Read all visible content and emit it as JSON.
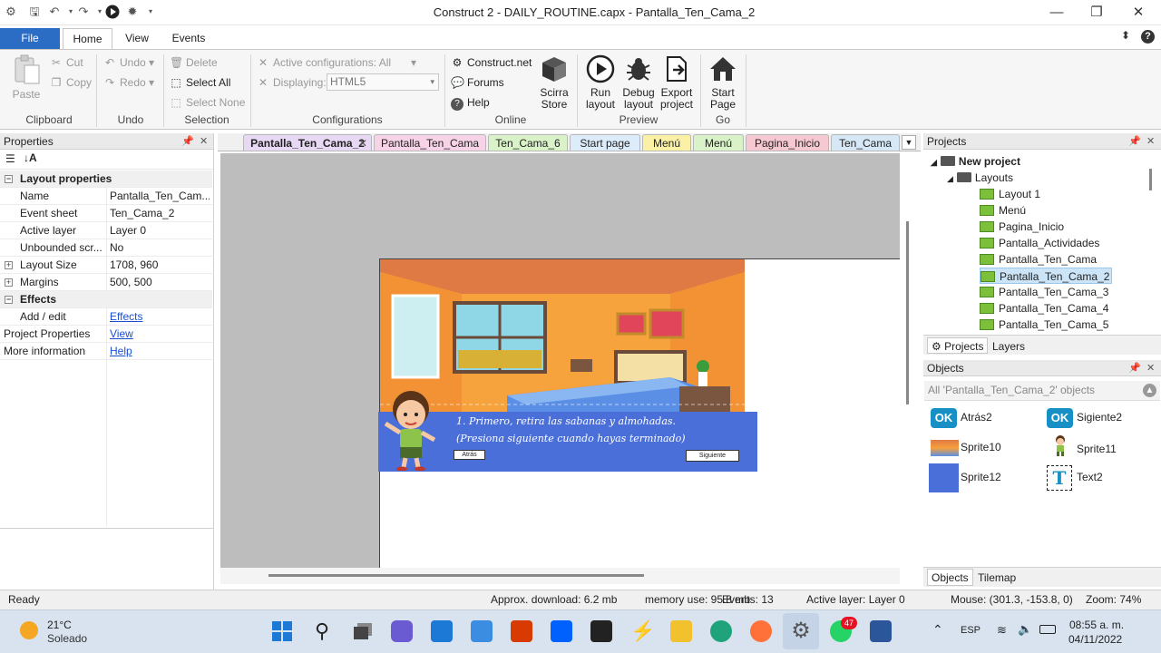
{
  "window": {
    "title": "Construct 2 - DAILY_ROUTINE.capx - Pantalla_Ten_Cama_2",
    "minimize": "—",
    "maximize": "❐",
    "close": "✕"
  },
  "ribbon": {
    "tabs": [
      "File",
      "Home",
      "View",
      "Events"
    ],
    "clipboard": {
      "label": "Clipboard",
      "paste": "Paste",
      "cut": "Cut",
      "copy": "Copy"
    },
    "undo": {
      "label": "Undo",
      "undo": "Undo",
      "redo": "Redo"
    },
    "selection": {
      "label": "Selection",
      "delete": "Delete",
      "select_all": "Select All",
      "select_none": "Select None"
    },
    "configurations": {
      "label": "Configurations",
      "active": "Active configurations: All",
      "displaying_label": "Displaying:",
      "displaying_value": "HTML5"
    },
    "online": {
      "label": "Online",
      "construct": "Construct.net",
      "forums": "Forums",
      "help": "Help",
      "store_line1": "Scirra",
      "store_line2": "Store"
    },
    "preview": {
      "label": "Preview",
      "run_line1": "Run",
      "run_line2": "layout",
      "debug_line1": "Debug",
      "debug_line2": "layout",
      "export_line1": "Export",
      "export_line2": "project"
    },
    "go": {
      "label": "Go",
      "start_line1": "Start",
      "start_line2": "Page"
    }
  },
  "properties": {
    "title": "Properties",
    "section_layout": "Layout properties",
    "rows": [
      {
        "k": "Name",
        "v": "Pantalla_Ten_Cam..."
      },
      {
        "k": "Event sheet",
        "v": "Ten_Cama_2"
      },
      {
        "k": "Active layer",
        "v": "Layer 0"
      },
      {
        "k": "Unbounded scr...",
        "v": "No"
      },
      {
        "k": "Layout Size",
        "v": "1708, 960"
      },
      {
        "k": "Margins",
        "v": "500, 500"
      }
    ],
    "section_effects": "Effects",
    "add_edit": "Add / edit",
    "effects_link": "Effects",
    "project_properties": "Project Properties",
    "view_link": "View",
    "more_information": "More information",
    "help_link": "Help"
  },
  "doc_tabs": [
    {
      "label": "Pantalla_Ten_Cama_2",
      "color": "#e7d8f3"
    },
    {
      "label": "Pantalla_Ten_Cama",
      "color": "#f6d3e6"
    },
    {
      "label": "Ten_Cama_6",
      "color": "#d9f2c7"
    },
    {
      "label": "Start page",
      "color": "#dcecfb"
    },
    {
      "label": "Menú",
      "color": "#fbf1a6"
    },
    {
      "label": "Menú",
      "color": "#d9f2c7"
    },
    {
      "label": "Pagina_Inicio",
      "color": "#f6c9d2"
    },
    {
      "label": "Ten_Cama",
      "color": "#d6e8f6"
    }
  ],
  "scene": {
    "line1": "1. Primero, retira las sabanas y almohadas.",
    "line2": "(Presiona siguiente cuando hayas terminado)",
    "back_btn": "Atrás",
    "next_btn": "Siguiente"
  },
  "projects": {
    "title": "Projects",
    "root": "New project",
    "folder": "Layouts",
    "layouts": [
      "Layout 1",
      "Menú",
      "Pagina_Inicio",
      "Pantalla_Actividades",
      "Pantalla_Ten_Cama",
      "Pantalla_Ten_Cama_2",
      "Pantalla_Ten_Cama_3",
      "Pantalla_Ten_Cama_4",
      "Pantalla_Ten_Cama_5"
    ],
    "tab_projects": "Projects",
    "tab_layers": "Layers"
  },
  "objects": {
    "title": "Objects",
    "filter": "All 'Pantalla_Ten_Cama_2' objects",
    "items": [
      "Atrás2",
      "Sigiente2",
      "Sprite10",
      "Sprite11",
      "Sprite12",
      "Text2"
    ],
    "ok_text": "OK",
    "tab_objects": "Objects",
    "tab_tilemap": "Tilemap"
  },
  "status": {
    "ready": "Ready",
    "download": "Approx. download: 6.2 mb",
    "memory": "memory use: 95.8 mb",
    "events": "Events: 13",
    "active_layer": "Active layer: Layer 0",
    "mouse": "Mouse: (301.3, -153.8, 0)",
    "zoom": "Zoom: 74%"
  },
  "taskbar": {
    "temp": "21°C",
    "weather": "Soleado",
    "lang": "ESP",
    "time": "08:55 a. m.",
    "date": "04/11/2022",
    "badge": "47"
  },
  "colors": {
    "accent": "#2b6cc4",
    "dialog_bar": "#4a6fd8",
    "selected_row": "#cce4f7"
  }
}
